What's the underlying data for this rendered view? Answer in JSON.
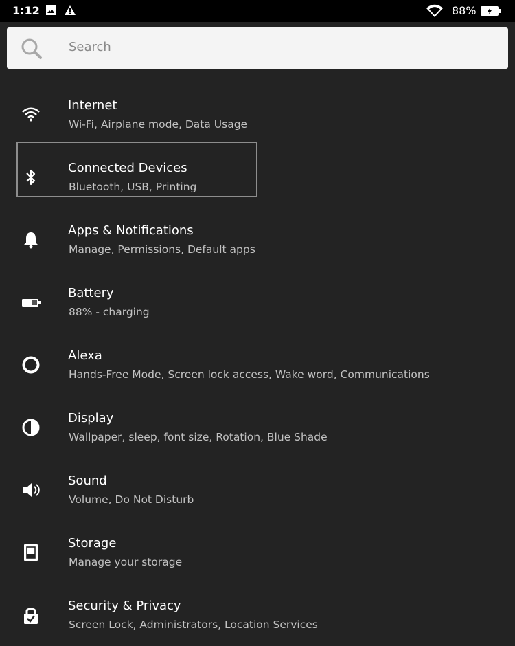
{
  "status_bar": {
    "time": "1:12",
    "battery_percent": "88%",
    "icons": [
      "image-icon",
      "warning-icon",
      "wifi-icon",
      "battery-charging-icon"
    ]
  },
  "search": {
    "placeholder": "Search"
  },
  "settings": {
    "items": [
      {
        "title": "Internet",
        "subtitle": "Wi-Fi, Airplane mode, Data Usage",
        "icon": "wifi-icon"
      },
      {
        "title": "Connected Devices",
        "subtitle": "Bluetooth, USB, Printing",
        "icon": "bluetooth-icon",
        "highlighted": true
      },
      {
        "title": "Apps & Notifications",
        "subtitle": "Manage, Permissions, Default apps",
        "icon": "bell-icon"
      },
      {
        "title": "Battery",
        "subtitle": "88% - charging",
        "icon": "battery-icon"
      },
      {
        "title": "Alexa",
        "subtitle": "Hands-Free Mode, Screen lock access, Wake word, Communications",
        "icon": "alexa-icon"
      },
      {
        "title": "Display",
        "subtitle": "Wallpaper, sleep, font size, Rotation, Blue Shade",
        "icon": "display-icon"
      },
      {
        "title": "Sound",
        "subtitle": "Volume, Do Not Disturb",
        "icon": "speaker-icon"
      },
      {
        "title": "Storage",
        "subtitle": "Manage your storage",
        "icon": "storage-icon"
      },
      {
        "title": "Security & Privacy",
        "subtitle": "Screen Lock, Administrators, Location Services",
        "icon": "lock-icon"
      }
    ]
  },
  "colors": {
    "background": "#232323",
    "status_bar": "#000000",
    "search_bg": "#f4f4f4",
    "subtitle": "#c2c2c2",
    "highlight_border": "#8d8d8d"
  }
}
